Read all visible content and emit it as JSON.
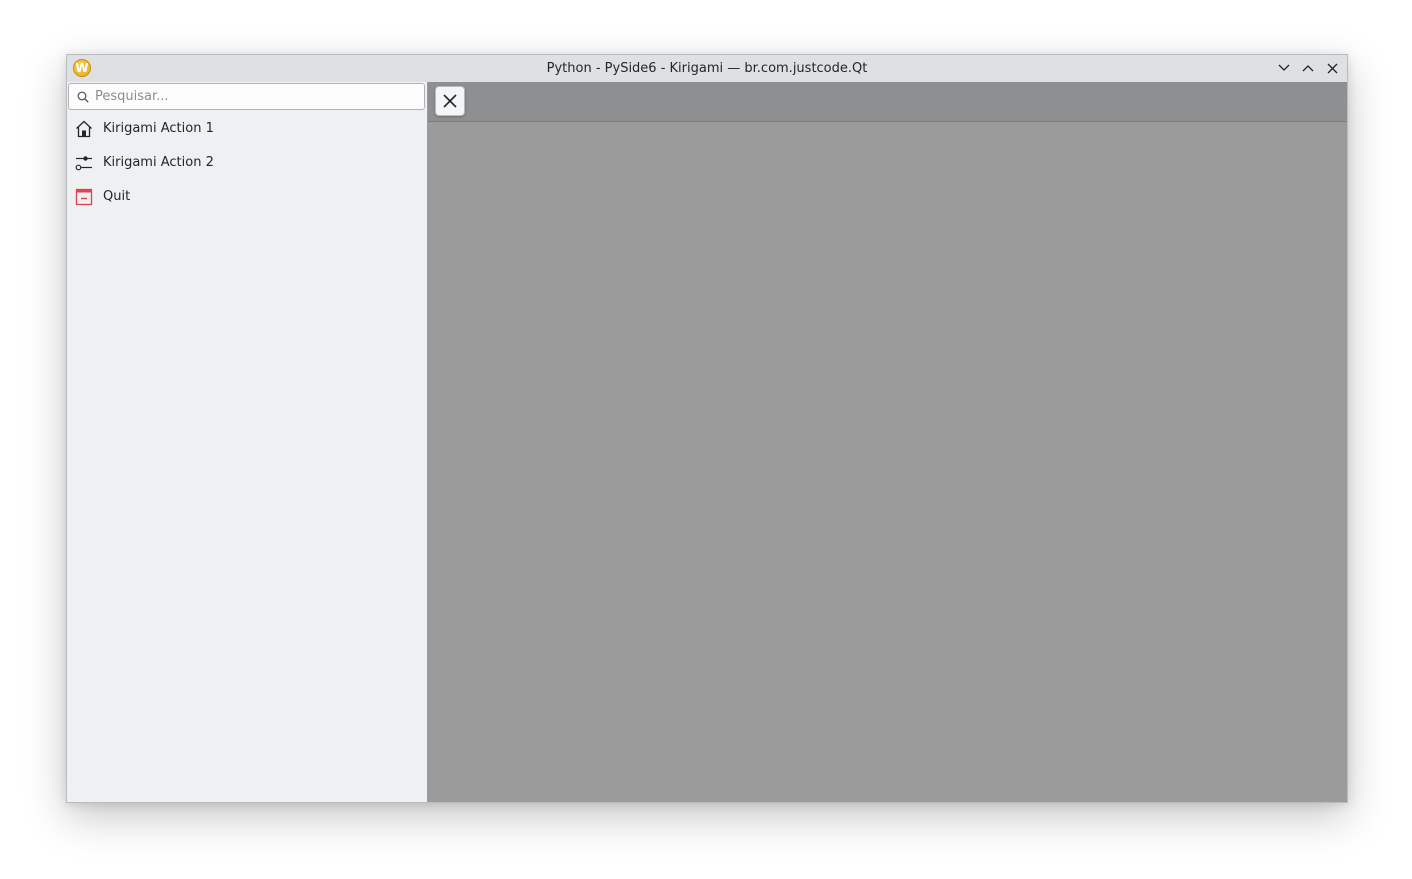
{
  "window": {
    "title": "Python - PySide6 - Kirigami — br.com.justcode.Qt",
    "app_icon_letter": "W",
    "app_icon_name": "app-icon",
    "controls": {
      "minimize_icon": "chevron-down-icon",
      "maximize_icon": "chevron-up-icon",
      "close_icon": "close-icon"
    }
  },
  "sidebar": {
    "search": {
      "placeholder": "Pesquisar...",
      "value": "",
      "icon": "search-icon"
    },
    "items": [
      {
        "label": "Kirigami Action 1",
        "icon": "home-icon"
      },
      {
        "label": "Kirigami Action 2",
        "icon": "settings-sliders-icon"
      },
      {
        "label": "Quit",
        "icon": "application-exit-icon",
        "icon_color": "#da4453"
      }
    ]
  },
  "content": {
    "close_button_icon": "close-icon",
    "background_color": "#9b9b9b",
    "header_color": "#8e8f90"
  }
}
